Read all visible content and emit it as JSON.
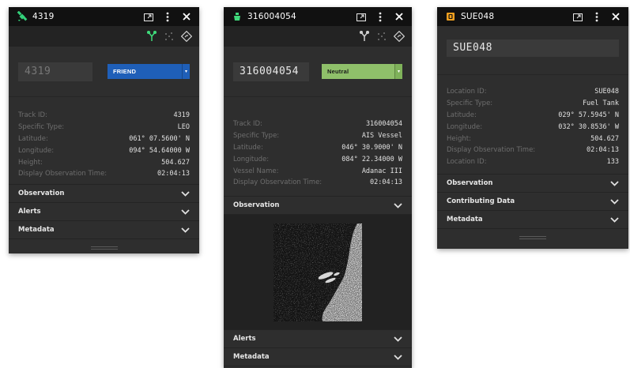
{
  "panels": [
    {
      "title": "4319",
      "title_icon": "satellite-icon",
      "id_value": "4319",
      "affiliation": {
        "label": "FRIEND",
        "color": "#1f5fb8",
        "caret": "▾"
      },
      "fields": [
        {
          "label": "Track ID:",
          "value": "4319"
        },
        {
          "label": "Specific Type:",
          "value": "LEO"
        },
        {
          "label": "Latitude:",
          "value": "061° 07.5600' N"
        },
        {
          "label": "Longitude:",
          "value": "094° 54.64000 W"
        },
        {
          "label": "Height:",
          "value": "504.627"
        },
        {
          "label": "Display Observation Time:",
          "value": "02:04:13"
        }
      ],
      "sections": [
        "Observation",
        "Alerts",
        "Metadata"
      ]
    },
    {
      "title": "316004054",
      "title_icon": "ship-icon",
      "id_value": "316004054",
      "affiliation": {
        "label": "Neutral",
        "color": "#8fc06a",
        "caret": "▾"
      },
      "fields": [
        {
          "label": "Track ID:",
          "value": "316004054"
        },
        {
          "label": "Specific Type:",
          "value": "AIS Vessel"
        },
        {
          "label": "Latitude:",
          "value": "046° 30.9000' N"
        },
        {
          "label": "Longitude:",
          "value": "084° 22.34000 W"
        },
        {
          "label": "Vessel Name:",
          "value": "Adanac III"
        },
        {
          "label": "Display Observation Time:",
          "value": "02:04:13"
        }
      ],
      "sections_top": [
        "Observation"
      ],
      "sections_bottom": [
        "Alerts",
        "Metadata"
      ]
    },
    {
      "title": "SUE048",
      "title_icon": "fuel-tank-icon",
      "id_value": "SUE048",
      "fields": [
        {
          "label": "Location ID:",
          "value": "SUE048"
        },
        {
          "label": "Specific Type:",
          "value": "Fuel Tank"
        },
        {
          "label": "Latitude:",
          "value": "029° 57.5945' N"
        },
        {
          "label": "Longitude:",
          "value": "032° 30.8536' W"
        },
        {
          "label": "Height:",
          "value": "504.627"
        },
        {
          "label": "Display Observation Time:",
          "value": "02:04:13"
        },
        {
          "label": "Location ID:",
          "value": "133"
        }
      ],
      "sections": [
        "Observation",
        "Contributing Data",
        "Metadata"
      ]
    }
  ],
  "colors": {
    "panel_bg": "#2e2e2e",
    "titlebar_bg": "#111111",
    "tool_green": "#3fd97a",
    "satellite_green": "#33d17a",
    "ship_green": "#3fd97a",
    "fuel_orange": "#f0a020"
  }
}
